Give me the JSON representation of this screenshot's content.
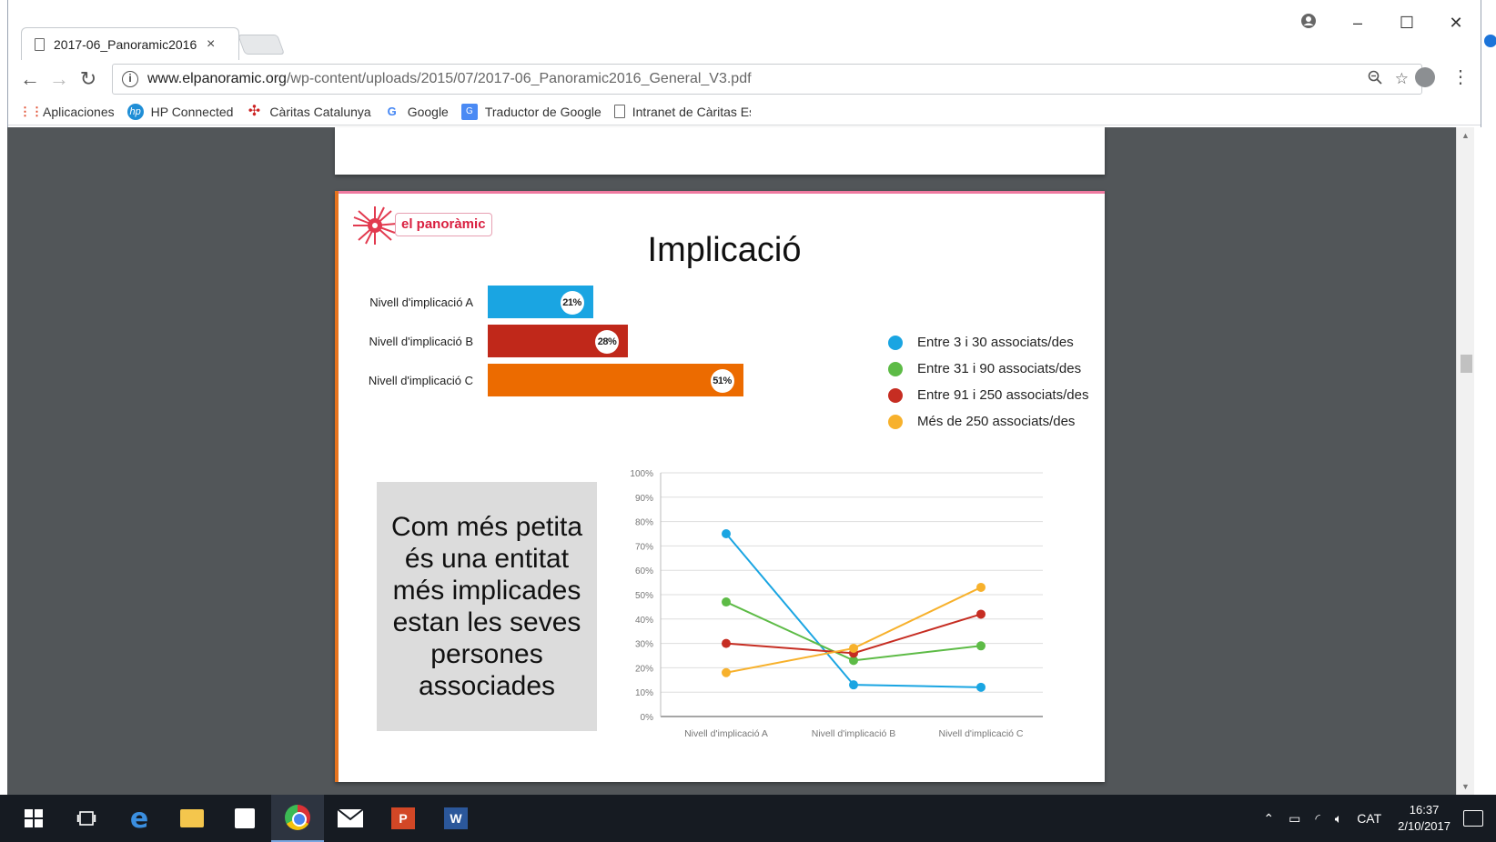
{
  "browser": {
    "tab_title": "2017-06_Panoramic2016",
    "tab_close": "×",
    "url_host": "www.elpanoramic.org",
    "url_path": "/wp-content/uploads/2015/07/2017-06_Panoramic2016_General_V3.pdf",
    "bookmarks": [
      {
        "label": "Aplicaciones",
        "icon": "apps-grid-icon"
      },
      {
        "label": "HP Connected",
        "icon": "hp-logo-icon"
      },
      {
        "label": "Càritas Catalunya",
        "icon": "caritas-logo-icon"
      },
      {
        "label": "Google",
        "icon": "google-g-icon"
      },
      {
        "label": "Traductor de Google",
        "icon": "translate-icon"
      },
      {
        "label": "Intranet de Càritas Es",
        "icon": "page-icon"
      }
    ]
  },
  "pdf": {
    "logo_text": "el panoràmic",
    "title": "Implicació",
    "bars": [
      {
        "label": "Nivell d'implicació A",
        "value": 21,
        "badge": "21%",
        "color": "#1aa5e2"
      },
      {
        "label": "Nivell d'implicació B",
        "value": 28,
        "badge": "28%",
        "color": "#c0281a"
      },
      {
        "label": "Nivell d'implicació C",
        "value": 51,
        "badge": "51%",
        "color": "#ec6b00"
      }
    ],
    "legend": [
      {
        "label": "Entre 3 i 30 associats/des",
        "color": "#1aa5e2"
      },
      {
        "label": "Entre 31 i 90 associats/des",
        "color": "#5dbb46"
      },
      {
        "label": "Entre 91 i 250 associats/des",
        "color": "#c62d22"
      },
      {
        "label": "Més de 250 associats/des",
        "color": "#f7b12c"
      }
    ],
    "callout": "Com més petita és una entitat més implicades estan les seves persones associades"
  },
  "chart_data": {
    "type": "line",
    "x": [
      "Nivell d'implicació A",
      "Nivell d'implicació B",
      "Nivell d'implicació C"
    ],
    "yticks": [
      "0%",
      "10%",
      "20%",
      "30%",
      "40%",
      "50%",
      "60%",
      "70%",
      "80%",
      "90%",
      "100%"
    ],
    "ylim": [
      0,
      100
    ],
    "grid": true,
    "series": [
      {
        "name": "Entre 3 i 30 associats/des",
        "values": [
          75,
          13,
          12
        ],
        "color": "#1aa5e2"
      },
      {
        "name": "Entre 31 i 90 associats/des",
        "values": [
          47,
          23,
          29
        ],
        "color": "#5dbb46"
      },
      {
        "name": "Entre 91 i 250 associats/des",
        "values": [
          30,
          26,
          42
        ],
        "color": "#c62d22"
      },
      {
        "name": "Més de 250 associats/des",
        "values": [
          18,
          28,
          53
        ],
        "color": "#f7b12c"
      }
    ]
  },
  "taskbar": {
    "lang": "CAT",
    "time": "16:37",
    "date": "2/10/2017"
  }
}
